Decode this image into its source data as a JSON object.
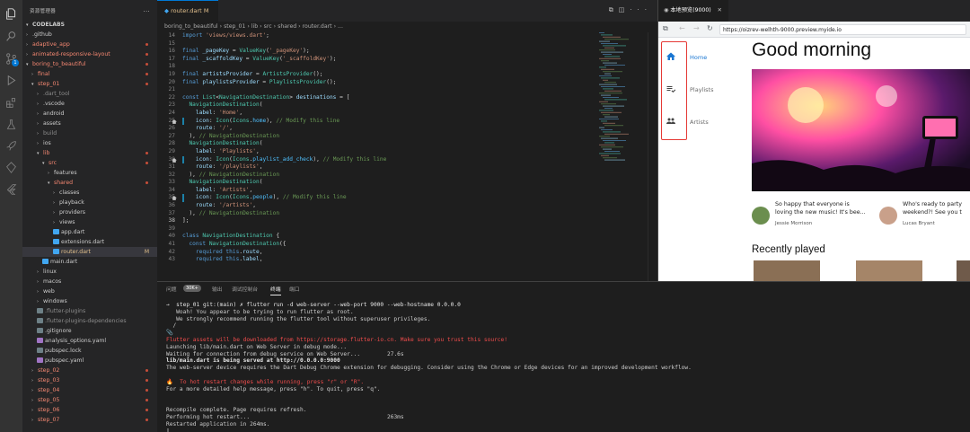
{
  "activity": {
    "badge": "1"
  },
  "sidebar": {
    "title": "资源管理器",
    "root": "CODELABS",
    "items": [
      {
        "label": ".github",
        "depth": 1,
        "folder": true,
        "open": false,
        "color": "#cccccc"
      },
      {
        "label": "adaptive_app",
        "depth": 1,
        "folder": true,
        "open": false,
        "color": "#f48771",
        "dot": true
      },
      {
        "label": "animated-responsive-layout",
        "depth": 1,
        "folder": true,
        "open": false,
        "color": "#f48771",
        "dot": true
      },
      {
        "label": "boring_to_beautiful",
        "depth": 1,
        "folder": true,
        "open": true,
        "color": "#f48771",
        "dot": true
      },
      {
        "label": "final",
        "depth": 2,
        "folder": true,
        "open": false,
        "color": "#f48771",
        "dot": true
      },
      {
        "label": "step_01",
        "depth": 2,
        "folder": true,
        "open": true,
        "color": "#f48771",
        "dot": true
      },
      {
        "label": ".dart_tool",
        "depth": 3,
        "folder": true,
        "open": false,
        "color": "#8c8c8c"
      },
      {
        "label": ".vscode",
        "depth": 3,
        "folder": true,
        "open": false,
        "color": "#cccccc"
      },
      {
        "label": "android",
        "depth": 3,
        "folder": true,
        "open": false,
        "color": "#cccccc"
      },
      {
        "label": "assets",
        "depth": 3,
        "folder": true,
        "open": false,
        "color": "#cccccc"
      },
      {
        "label": "build",
        "depth": 3,
        "folder": true,
        "open": false,
        "color": "#8c8c8c"
      },
      {
        "label": "ios",
        "depth": 3,
        "folder": true,
        "open": false,
        "color": "#cccccc"
      },
      {
        "label": "lib",
        "depth": 3,
        "folder": true,
        "open": true,
        "color": "#f48771",
        "dot": true
      },
      {
        "label": "src",
        "depth": 4,
        "folder": true,
        "open": true,
        "color": "#f48771",
        "dot": true
      },
      {
        "label": "features",
        "depth": 5,
        "folder": true,
        "open": false,
        "color": "#cccccc"
      },
      {
        "label": "shared",
        "depth": 5,
        "folder": true,
        "open": true,
        "color": "#f48771",
        "dot": true
      },
      {
        "label": "classes",
        "depth": 6,
        "folder": true,
        "open": false,
        "color": "#cccccc"
      },
      {
        "label": "playback",
        "depth": 6,
        "folder": true,
        "open": false,
        "color": "#cccccc"
      },
      {
        "label": "providers",
        "depth": 6,
        "folder": true,
        "open": false,
        "color": "#cccccc"
      },
      {
        "label": "views",
        "depth": 6,
        "folder": true,
        "open": false,
        "color": "#cccccc"
      },
      {
        "label": "app.dart",
        "depth": 6,
        "folder": false,
        "color": "#cccccc"
      },
      {
        "label": "extensions.dart",
        "depth": 6,
        "folder": false,
        "color": "#cccccc"
      },
      {
        "label": "router.dart",
        "depth": 6,
        "folder": false,
        "color": "#e2c08d",
        "mod": "M",
        "selected": true
      },
      {
        "label": "main.dart",
        "depth": 4,
        "folder": false,
        "color": "#cccccc"
      },
      {
        "label": "linux",
        "depth": 3,
        "folder": true,
        "open": false,
        "color": "#cccccc"
      },
      {
        "label": "macos",
        "depth": 3,
        "folder": true,
        "open": false,
        "color": "#cccccc"
      },
      {
        "label": "web",
        "depth": 3,
        "folder": true,
        "open": false,
        "color": "#cccccc"
      },
      {
        "label": "windows",
        "depth": 3,
        "folder": true,
        "open": false,
        "color": "#cccccc"
      },
      {
        "label": ".flutter-plugins",
        "depth": 3,
        "folder": false,
        "color": "#8c8c8c"
      },
      {
        "label": ".flutter-plugins-dependencies",
        "depth": 3,
        "folder": false,
        "color": "#8c8c8c"
      },
      {
        "label": ".gitignore",
        "depth": 3,
        "folder": false,
        "color": "#cccccc"
      },
      {
        "label": "analysis_options.yaml",
        "depth": 3,
        "folder": false,
        "color": "#cccccc"
      },
      {
        "label": "pubspec.lock",
        "depth": 3,
        "folder": false,
        "color": "#cccccc"
      },
      {
        "label": "pubspec.yaml",
        "depth": 3,
        "folder": false,
        "color": "#cccccc"
      },
      {
        "label": "step_02",
        "depth": 2,
        "folder": true,
        "open": false,
        "color": "#f48771",
        "dot": true
      },
      {
        "label": "step_03",
        "depth": 2,
        "folder": true,
        "open": false,
        "color": "#f48771",
        "dot": true
      },
      {
        "label": "step_04",
        "depth": 2,
        "folder": true,
        "open": false,
        "color": "#f48771",
        "dot": true
      },
      {
        "label": "step_05",
        "depth": 2,
        "folder": true,
        "open": false,
        "color": "#f48771",
        "dot": true
      },
      {
        "label": "step_06",
        "depth": 2,
        "folder": true,
        "open": false,
        "color": "#f48771",
        "dot": true
      },
      {
        "label": "step_07",
        "depth": 2,
        "folder": true,
        "open": false,
        "color": "#f48771",
        "dot": true
      }
    ]
  },
  "editor": {
    "tab": "router.dart",
    "tab_mod": "M",
    "breadcrumb": [
      "boring_to_beautiful",
      "step_01",
      "lib",
      "src",
      "shared",
      "router.dart",
      "..."
    ],
    "lines": [
      {
        "n": "14",
        "code": [
          [
            "k",
            "import "
          ],
          [
            "s",
            "'views/views.dart'"
          ],
          [
            "p",
            ";"
          ]
        ]
      },
      {
        "n": "15",
        "code": []
      },
      {
        "n": "16",
        "code": [
          [
            "k",
            "final "
          ],
          [
            "v",
            "_pageKey"
          ],
          [
            "p",
            " = "
          ],
          [
            "t",
            "ValueKey"
          ],
          [
            "p",
            "("
          ],
          [
            "s",
            "'_pageKey'"
          ],
          [
            "p",
            ");"
          ]
        ]
      },
      {
        "n": "17",
        "code": [
          [
            "k",
            "final "
          ],
          [
            "v",
            "_scaffoldKey"
          ],
          [
            "p",
            " = "
          ],
          [
            "t",
            "ValueKey"
          ],
          [
            "p",
            "("
          ],
          [
            "s",
            "'_scaffoldKey'"
          ],
          [
            "p",
            ");"
          ]
        ]
      },
      {
        "n": "18",
        "code": []
      },
      {
        "n": "19",
        "code": [
          [
            "k",
            "final "
          ],
          [
            "v",
            "artistsProvider"
          ],
          [
            "p",
            " = "
          ],
          [
            "t",
            "ArtistsProvider"
          ],
          [
            "p",
            "();"
          ]
        ]
      },
      {
        "n": "20",
        "code": [
          [
            "k",
            "final "
          ],
          [
            "v",
            "playlistsProvider"
          ],
          [
            "p",
            " = "
          ],
          [
            "t",
            "PlaylistsProvider"
          ],
          [
            "p",
            "();"
          ]
        ]
      },
      {
        "n": "21",
        "code": []
      },
      {
        "n": "22",
        "code": [
          [
            "k",
            "const "
          ],
          [
            "t",
            "List"
          ],
          [
            "p",
            "<"
          ],
          [
            "t",
            "NavigationDestination"
          ],
          [
            "p",
            "> "
          ],
          [
            "v",
            "destinations"
          ],
          [
            "p",
            " = ["
          ]
        ]
      },
      {
        "n": "23",
        "code": [
          [
            "p",
            "  "
          ],
          [
            "t",
            "NavigationDestination"
          ],
          [
            "p",
            "("
          ]
        ]
      },
      {
        "n": "24",
        "code": [
          [
            "p",
            "    "
          ],
          [
            "v",
            "label"
          ],
          [
            "p",
            ": "
          ],
          [
            "s",
            "'Home'"
          ],
          [
            "p",
            ","
          ]
        ]
      },
      {
        "n": "25",
        "code": [
          [
            "p",
            "    "
          ],
          [
            "v",
            "icon"
          ],
          [
            "p",
            ": "
          ],
          [
            "t",
            "Icon"
          ],
          [
            "p",
            "("
          ],
          [
            "t",
            "Icons"
          ],
          [
            "p",
            "."
          ],
          [
            "cc",
            "home"
          ],
          [
            "p",
            "), "
          ],
          [
            "c",
            "// Modify this line"
          ]
        ],
        "glyph": true,
        "mark": true
      },
      {
        "n": "26",
        "code": [
          [
            "p",
            "    "
          ],
          [
            "v",
            "route"
          ],
          [
            "p",
            ": "
          ],
          [
            "s",
            "'/'"
          ],
          [
            "p",
            ","
          ]
        ]
      },
      {
        "n": "27",
        "code": [
          [
            "p",
            "  ), "
          ],
          [
            "c",
            "// NavigationDestination"
          ]
        ]
      },
      {
        "n": "28",
        "code": [
          [
            "p",
            "  "
          ],
          [
            "t",
            "NavigationDestination"
          ],
          [
            "p",
            "("
          ]
        ]
      },
      {
        "n": "29",
        "code": [
          [
            "p",
            "    "
          ],
          [
            "v",
            "label"
          ],
          [
            "p",
            ": "
          ],
          [
            "s",
            "'Playlists'"
          ],
          [
            "p",
            ","
          ]
        ]
      },
      {
        "n": "30",
        "code": [
          [
            "p",
            "    "
          ],
          [
            "v",
            "icon"
          ],
          [
            "p",
            ": "
          ],
          [
            "t",
            "Icon"
          ],
          [
            "p",
            "("
          ],
          [
            "t",
            "Icons"
          ],
          [
            "p",
            "."
          ],
          [
            "cc",
            "playlist_add_check"
          ],
          [
            "p",
            "), "
          ],
          [
            "c",
            "// Modify this line"
          ]
        ],
        "glyph": true,
        "mark": true
      },
      {
        "n": "31",
        "code": [
          [
            "p",
            "    "
          ],
          [
            "v",
            "route"
          ],
          [
            "p",
            ": "
          ],
          [
            "s",
            "'/playlists'"
          ],
          [
            "p",
            ","
          ]
        ]
      },
      {
        "n": "32",
        "code": [
          [
            "p",
            "  ), "
          ],
          [
            "c",
            "// NavigationDestination"
          ]
        ]
      },
      {
        "n": "33",
        "code": [
          [
            "p",
            "  "
          ],
          [
            "t",
            "NavigationDestination"
          ],
          [
            "p",
            "("
          ]
        ]
      },
      {
        "n": "34",
        "code": [
          [
            "p",
            "    "
          ],
          [
            "v",
            "label"
          ],
          [
            "p",
            ": "
          ],
          [
            "s",
            "'Artists'"
          ],
          [
            "p",
            ","
          ]
        ]
      },
      {
        "n": "35",
        "code": [
          [
            "p",
            "    "
          ],
          [
            "v",
            "icon"
          ],
          [
            "p",
            ": "
          ],
          [
            "t",
            "Icon"
          ],
          [
            "p",
            "("
          ],
          [
            "t",
            "Icons"
          ],
          [
            "p",
            "."
          ],
          [
            "cc",
            "people"
          ],
          [
            "p",
            "), "
          ],
          [
            "c",
            "// Modify this line"
          ]
        ],
        "glyph": true,
        "mark": true
      },
      {
        "n": "36",
        "code": [
          [
            "p",
            "    "
          ],
          [
            "v",
            "route"
          ],
          [
            "p",
            ": "
          ],
          [
            "s",
            "'/artists'"
          ],
          [
            "p",
            ","
          ]
        ]
      },
      {
        "n": "37",
        "code": [
          [
            "p",
            "  ), "
          ],
          [
            "c",
            "// NavigationDestination"
          ]
        ]
      },
      {
        "n": "38",
        "code": [
          [
            "p",
            "];"
          ]
        ],
        "current": true
      },
      {
        "n": "39",
        "code": []
      },
      {
        "n": "40",
        "code": [
          [
            "k",
            "class "
          ],
          [
            "t",
            "NavigationDestination"
          ],
          [
            "p",
            " {"
          ]
        ]
      },
      {
        "n": "41",
        "code": [
          [
            "p",
            "  "
          ],
          [
            "k",
            "const "
          ],
          [
            "t",
            "NavigationDestination"
          ],
          [
            "p",
            "({"
          ]
        ]
      },
      {
        "n": "42",
        "code": [
          [
            "p",
            "    "
          ],
          [
            "k",
            "required this"
          ],
          [
            "p",
            "."
          ],
          [
            "v",
            "route"
          ],
          [
            "p",
            ","
          ]
        ]
      },
      {
        "n": "43",
        "code": [
          [
            "p",
            "    "
          ],
          [
            "k",
            "required this"
          ],
          [
            "p",
            "."
          ],
          [
            "v",
            "label"
          ],
          [
            "p",
            ","
          ]
        ]
      }
    ]
  },
  "preview": {
    "tab": "本地预览(9000)",
    "url": "https://oizrev-welhth-9000.preview.myide.io",
    "rail": [
      {
        "label": "Home",
        "icon": "home-icon",
        "active": true
      },
      {
        "label": "Playlists",
        "icon": "playlist-add-check-icon",
        "active": false
      },
      {
        "label": "Artists",
        "icon": "people-icon",
        "active": false
      }
    ],
    "greeting": "Good morning",
    "cards": [
      {
        "message": "So happy that everyone is\nloving the new music! It's bee...",
        "author": "Jessie Morrison"
      },
      {
        "message": "Who's ready to party\nweekend?! See you t",
        "author": "Lucas Bryant"
      }
    ],
    "recent_title": "Recently played"
  },
  "panel": {
    "tabs": [
      "问题",
      "输出",
      "调试控制台",
      "终端",
      "端口"
    ],
    "problems_badge": "30K+",
    "active_tab": "终端",
    "terminal": [
      {
        "text": "→  step_01 git:(main) ✗ flutter run -d web-server --web-port 9000 --web-hostname 0.0.0.0",
        "style": "prompt"
      },
      {
        "text": "   Woah! You appear to be trying to run flutter as root.",
        "style": ""
      },
      {
        "text": "   We strongly recommend running the flutter tool without superuser privileges.",
        "style": ""
      },
      {
        "text": "  /",
        "style": ""
      },
      {
        "text": "📎",
        "style": ""
      },
      {
        "text": "Flutter assets will be downloaded from https://storage.flutter-io.cn. Make sure you trust this source!",
        "style": "red"
      },
      {
        "text": "Launching lib/main.dart on Web Server in debug mode...",
        "style": ""
      },
      {
        "text": "Waiting for connection from debug service on Web Server...",
        "style": "",
        "time": "27.6s"
      },
      {
        "text": "lib/main.dart is being served at http://0.0.0.0:9000",
        "style": "bold"
      },
      {
        "text": "The web-server device requires the Dart Debug Chrome extension for debugging. Consider using the Chrome or Edge devices for an improved development workflow.",
        "style": ""
      },
      {
        "text": "",
        "style": ""
      },
      {
        "text": "🔥  To hot restart changes while running, press \"r\" or \"R\".",
        "style": "red"
      },
      {
        "text": "For a more detailed help message, press \"h\". To quit, press \"q\".",
        "style": ""
      },
      {
        "text": "",
        "style": ""
      },
      {
        "text": "",
        "style": ""
      },
      {
        "text": "Recompile complete. Page requires refresh.",
        "style": ""
      },
      {
        "text": "Performing hot restart...",
        "style": "",
        "time": "263ms"
      },
      {
        "text": "Restarted application in 264ms.",
        "style": ""
      },
      {
        "text": "▯",
        "style": ""
      }
    ]
  }
}
